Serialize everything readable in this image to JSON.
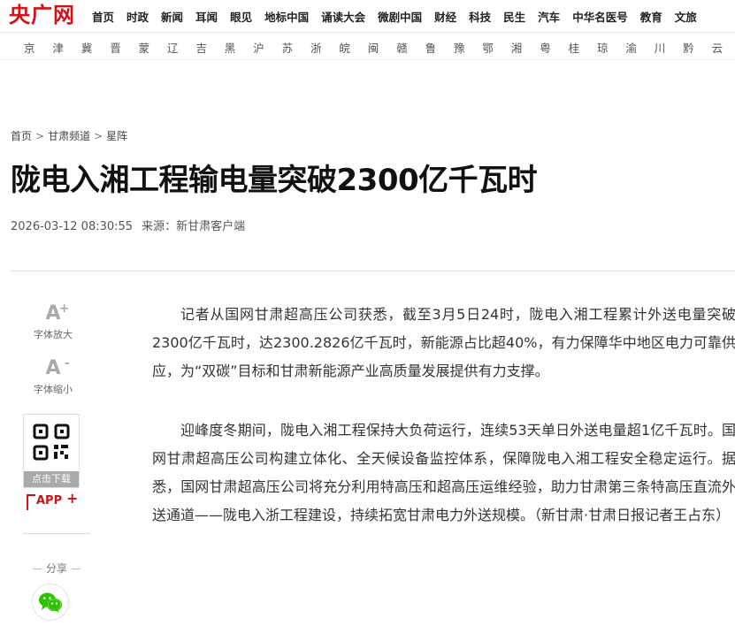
{
  "site": {
    "logo": "央广网",
    "nav": [
      "首页",
      "时政",
      "新闻",
      "耳闻",
      "眼见",
      "地标中国",
      "诵读大会",
      "微剧中国",
      "财经",
      "科技",
      "民生",
      "汽车",
      "中华名医号",
      "教育",
      "文旅"
    ],
    "provinces": [
      "京",
      "津",
      "冀",
      "晋",
      "蒙",
      "辽",
      "吉",
      "黑",
      "沪",
      "苏",
      "浙",
      "皖",
      "闽",
      "赣",
      "鲁",
      "豫",
      "鄂",
      "湘",
      "粤",
      "桂",
      "琼",
      "渝",
      "川",
      "黔",
      "云"
    ]
  },
  "breadcrumb": {
    "items": [
      "首页",
      "甘肃频道",
      "星阵"
    ],
    "separator": ">"
  },
  "article": {
    "title": "陇电入湘工程输电量突破2300亿千瓦时",
    "date": "2026-03-12 08:30:55",
    "source": "来源：新甘肃客户端",
    "paragraphs": [
      "记者从国网甘肃超高压公司获悉，截至3月5日24时，陇电入湘工程累计外送电量突破2300亿千瓦时，达2300.2826亿千瓦时，新能源占比超40%，有力保障华中地区电力可靠供应，为“双碳”目标和甘肃新能源产业高质量发展提供有力支撑。",
      "迎峰度冬期间，陇电入湘工程保持大负荷运行，连续53天单日外送电量超1亿千瓦时。国网甘肃超高压公司构建立体化、全天候设备监控体系，保障陇电入湘工程安全稳定运行。据悉，国网甘肃超高压公司将充分利用特高压和超高压运维经验，助力甘肃第三条特高压直流外送通道——陇电入浙工程建设，持续拓宽甘肃电力外送规模。（新甘肃·甘肃日报记者王占东）"
    ]
  },
  "tools": {
    "font_up": {
      "glyph": "A",
      "mark": "+",
      "label": "字体放大"
    },
    "font_down": {
      "glyph": "A",
      "mark": "-",
      "label": "字体缩小"
    },
    "download": "点击下载",
    "app": "APP",
    "app_plus": "+",
    "share": "分享"
  },
  "colors": {
    "brand": "#d0121b",
    "app": "#c4161c",
    "wechat": "#2dc100"
  }
}
